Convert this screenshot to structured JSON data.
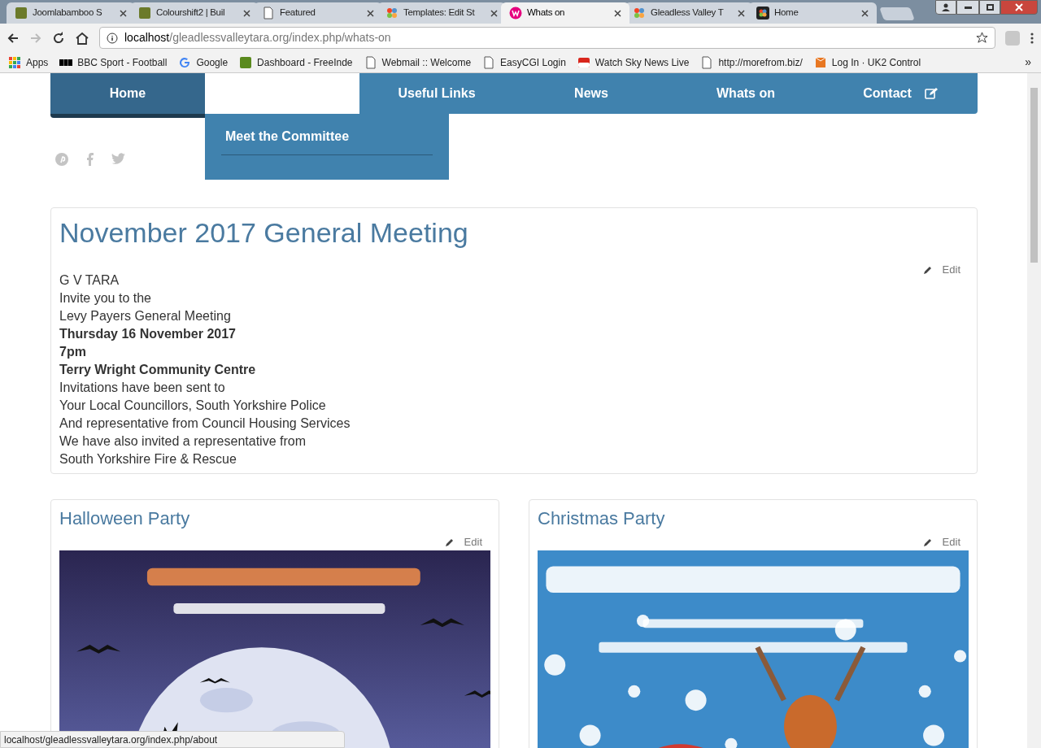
{
  "browser": {
    "tabs": [
      {
        "title": "Joomlabamboo S",
        "kind": "bamboo",
        "selected": false
      },
      {
        "title": "Colourshift2 | Buil",
        "kind": "bamboo",
        "selected": false
      },
      {
        "title": "Featured",
        "kind": "page",
        "selected": false
      },
      {
        "title": "Templates: Edit St",
        "kind": "joomla",
        "selected": false
      },
      {
        "title": "Whats on",
        "kind": "wamp",
        "selected": true
      },
      {
        "title": "Gleadless Valley T",
        "kind": "joomla",
        "selected": false
      },
      {
        "title": "Home",
        "kind": "dark",
        "selected": false
      }
    ],
    "address": {
      "host": "localhost",
      "path": "/gleadlessvalleytara.org/index.php/whats-on"
    },
    "bookmarks": [
      {
        "label": "Apps",
        "kind": "apps"
      },
      {
        "label": "BBC Sport - Football",
        "kind": "bbc"
      },
      {
        "label": "Google",
        "kind": "google"
      },
      {
        "label": "Dashboard - FreeInde",
        "kind": "fi"
      },
      {
        "label": "Webmail :: Welcome",
        "kind": "page"
      },
      {
        "label": "EasyCGI Login",
        "kind": "page"
      },
      {
        "label": "Watch Sky News Live",
        "kind": "sky"
      },
      {
        "label": "http://morefrom.biz/",
        "kind": "page"
      },
      {
        "label": "Log In · UK2 Control",
        "kind": "box"
      }
    ],
    "more": "»",
    "status_url": "localhost/gleadlessvalleytara.org/index.php/about"
  },
  "nav": {
    "items": [
      {
        "label": "Home",
        "kind": "link",
        "selected": true
      },
      {
        "kind": "hovered",
        "selected": false
      },
      {
        "label": "Useful Links",
        "kind": "link",
        "selected": false
      },
      {
        "label": "News",
        "kind": "link",
        "selected": false
      },
      {
        "label": "Whats on",
        "kind": "link",
        "selected": false
      },
      {
        "label": "Contact",
        "kind": "contact",
        "selected": false
      }
    ],
    "dropdown": [
      "Meet the Committee"
    ]
  },
  "article": {
    "title": "November 2017 General Meeting",
    "edit": "Edit",
    "lines": [
      {
        "text": "G V TARA",
        "bold": false
      },
      {
        "text": "Invite you to the",
        "bold": false
      },
      {
        "text": "Levy Payers General Meeting",
        "bold": false
      },
      {
        "text": "Thursday 16 November 2017",
        "bold": true
      },
      {
        "text": "7pm",
        "bold": true
      },
      {
        "text": "Terry Wright Community Centre",
        "bold": true
      },
      {
        "text": "Invitations have been sent to",
        "bold": false
      },
      {
        "text": "Your Local Councillors, South Yorkshire Police",
        "bold": false
      },
      {
        "text": "And representative from Council Housing Services",
        "bold": false
      },
      {
        "text": "We have also invited a representative from",
        "bold": false
      },
      {
        "text": "South Yorkshire Fire & Rescue",
        "bold": false
      }
    ]
  },
  "cards": [
    {
      "title": "Halloween Party",
      "edit": "Edit",
      "kind": "picture"
    },
    {
      "title": "Christmas Party",
      "edit": "Edit",
      "kind": "picture"
    }
  ]
}
